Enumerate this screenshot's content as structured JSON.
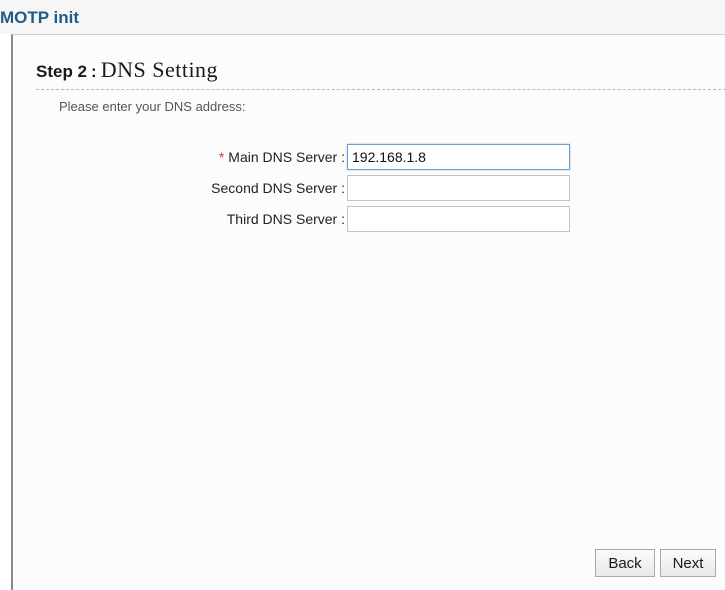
{
  "app": {
    "title": "MOTP init"
  },
  "wizard": {
    "step_label": "Step 2",
    "step_separator": ":",
    "step_title": "DNS Setting",
    "instruction": "Please enter your DNS address:"
  },
  "form": {
    "required_mark": "*",
    "main_dns": {
      "label": "Main DNS Server :",
      "value": "192.168.1.8",
      "required": true
    },
    "second_dns": {
      "label": "Second DNS Server :",
      "value": ""
    },
    "third_dns": {
      "label": "Third DNS Server :",
      "value": ""
    }
  },
  "buttons": {
    "back_label": "Back",
    "next_label": "Next"
  },
  "colors": {
    "title_blue": "#1f5c8c",
    "required_red": "#d9302c",
    "focus_border": "#6f9ed4"
  }
}
